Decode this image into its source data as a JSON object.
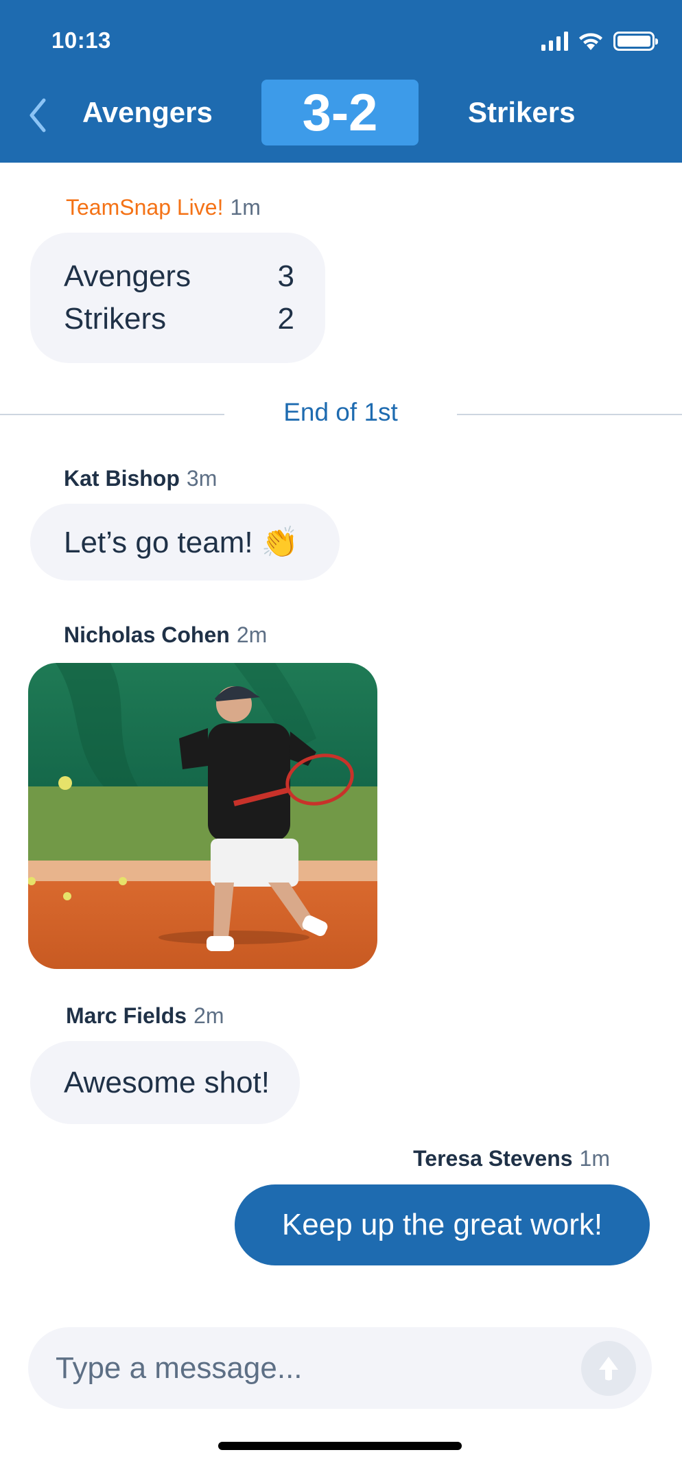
{
  "status_bar": {
    "time": "10:13",
    "icons": [
      "cellular-signal-icon",
      "wifi-icon",
      "battery-icon"
    ]
  },
  "header": {
    "back_icon": "chevron-left-icon",
    "home_team": "Avengers",
    "away_team": "Strikers",
    "score": "3-2",
    "colors": {
      "bar": "#1e6bb0",
      "score_box": "#3d9be9",
      "back_chevron": "#8cc4f5"
    }
  },
  "messages": [
    {
      "type": "score_update",
      "sender": "TeamSnap Live!",
      "time": "1m",
      "sender_color": "#f47216",
      "rows": [
        {
          "team": "Avengers",
          "score": "3"
        },
        {
          "team": "Strikers",
          "score": "2"
        }
      ]
    },
    {
      "type": "divider",
      "label": "End of 1st"
    },
    {
      "type": "text",
      "sender": "Kat Bishop",
      "time": "3m",
      "text": "Let’s go team! 👏"
    },
    {
      "type": "image",
      "sender": "Nicholas Cohen",
      "time": "2m",
      "image_alt": "Older man in a black t-shirt, white shorts and cap hitting a tennis ball on a clay court"
    },
    {
      "type": "text",
      "sender": "Marc Fields",
      "time": "2m",
      "text": "Awesome shot!"
    },
    {
      "type": "own_text",
      "sender": "Teresa Stevens",
      "time": "1m",
      "text": "Keep up the great work!",
      "bubble_color": "#1e6bb0"
    }
  ],
  "composer": {
    "placeholder": "Type a message...",
    "value": "",
    "send_icon": "arrow-up-icon"
  }
}
